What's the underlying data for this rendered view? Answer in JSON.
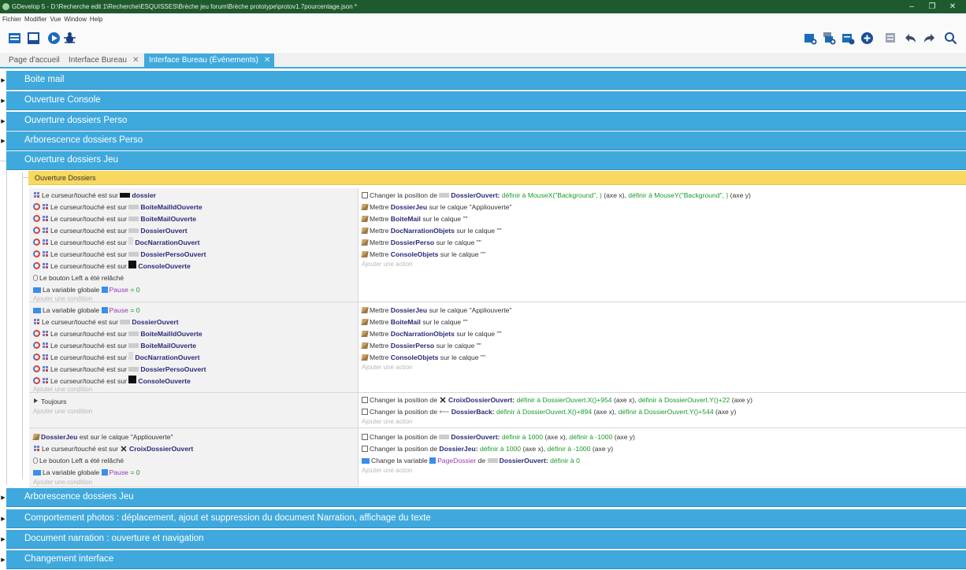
{
  "window": {
    "title": "GDevelop 5 - D:\\Recherche edit 1\\Recherche\\ESQUISSES\\Brèche jeu forum\\Brèche prototype\\protov1.7pourcentage.json *",
    "controls": [
      "–",
      "❐",
      "✕"
    ]
  },
  "menu": [
    "Fichier",
    "Modifier",
    "Vue",
    "Window",
    "Help"
  ],
  "tabs": [
    {
      "label": "Page d'accueil",
      "closable": false
    },
    {
      "label": "Interface Bureau",
      "closable": true
    },
    {
      "label": "Interface Bureau (Événements)",
      "closable": true,
      "active": true
    }
  ],
  "colors": {
    "accent": "#3fa9dd",
    "subgroup": "#f8d85e",
    "titlebar": "#1e5a2e"
  },
  "groups_top": [
    "Boite mail",
    "Ouverture Console",
    "Ouverture dossiers Perso",
    "Arborescence dossiers Perso",
    "Ouverture dossiers Jeu"
  ],
  "subgroup": "Ouverture Dossiers",
  "placeholders": {
    "add_condition": "Ajouter une condition",
    "add_action": "Ajouter une action"
  },
  "text": {
    "cursor_on": "Le curseur/touché est sur",
    "button_released_pre": "Le bouton",
    "button_left": "Left",
    "button_released_post": "a été relâché",
    "global_var": "La variable globale",
    "pause": "Pause",
    "eq_zero": "= 0",
    "always": "Toujours",
    "put": "Mettre",
    "on_layer": "sur le calque",
    "is_on_layer": "est sur le calque",
    "change_pos": "Changer la position de",
    "set_to": "définir à",
    "axe_x": "(axe x),",
    "axe_y": "(axe y)",
    "change_var": "Change la variable",
    "of": "de",
    "set_to_zero": "définir à 0"
  },
  "objects": {
    "dossier": "dossier",
    "boite_maild_ouverte": "BoiteMailldOuverte",
    "boite_mail_ouverte": "BoiteMailOuverte",
    "dossier_ouvert": "DossierOuvert",
    "doc_narration_ouvert": "DocNarrationOuvert",
    "dossier_perso_ouvert": "DossierPersoOuvert",
    "console_ouverte": "ConsoleOuverte",
    "dossier_jeu": "DossierJeu",
    "croix_dossier_ouvert": "CroixDossierOuvert",
    "dossier_back": "DossierBack",
    "boite_mail": "BoiteMail",
    "doc_narration_objets": "DocNarrationObjets",
    "dossier_perso": "DossierPerso",
    "console_objets": "ConsoleObjets",
    "page_dossier": "PageDossier"
  },
  "layers": {
    "applio": "\"Appliouverte\"",
    "empty": "\"\""
  },
  "expr": {
    "mouse_x": "MouseX(\"Background\", )",
    "mouse_y": "MouseY(\"Background\", )",
    "croix_x": "DossierOuvert.X()+954",
    "croix_y": "DossierOuvert.Y()+22",
    "back_x": "DossierOuvert.X()+894",
    "back_y": "DossierOuvert.Y()+544",
    "v1000": "1000",
    "vm1000": "-1000"
  },
  "groups_bottom": [
    "Arborescence dossiers Jeu",
    "Comportement photos : déplacement, ajout et suppression du document Narration, affichage du texte",
    "Document narration : ouverture et navigation",
    "Changement interface"
  ]
}
